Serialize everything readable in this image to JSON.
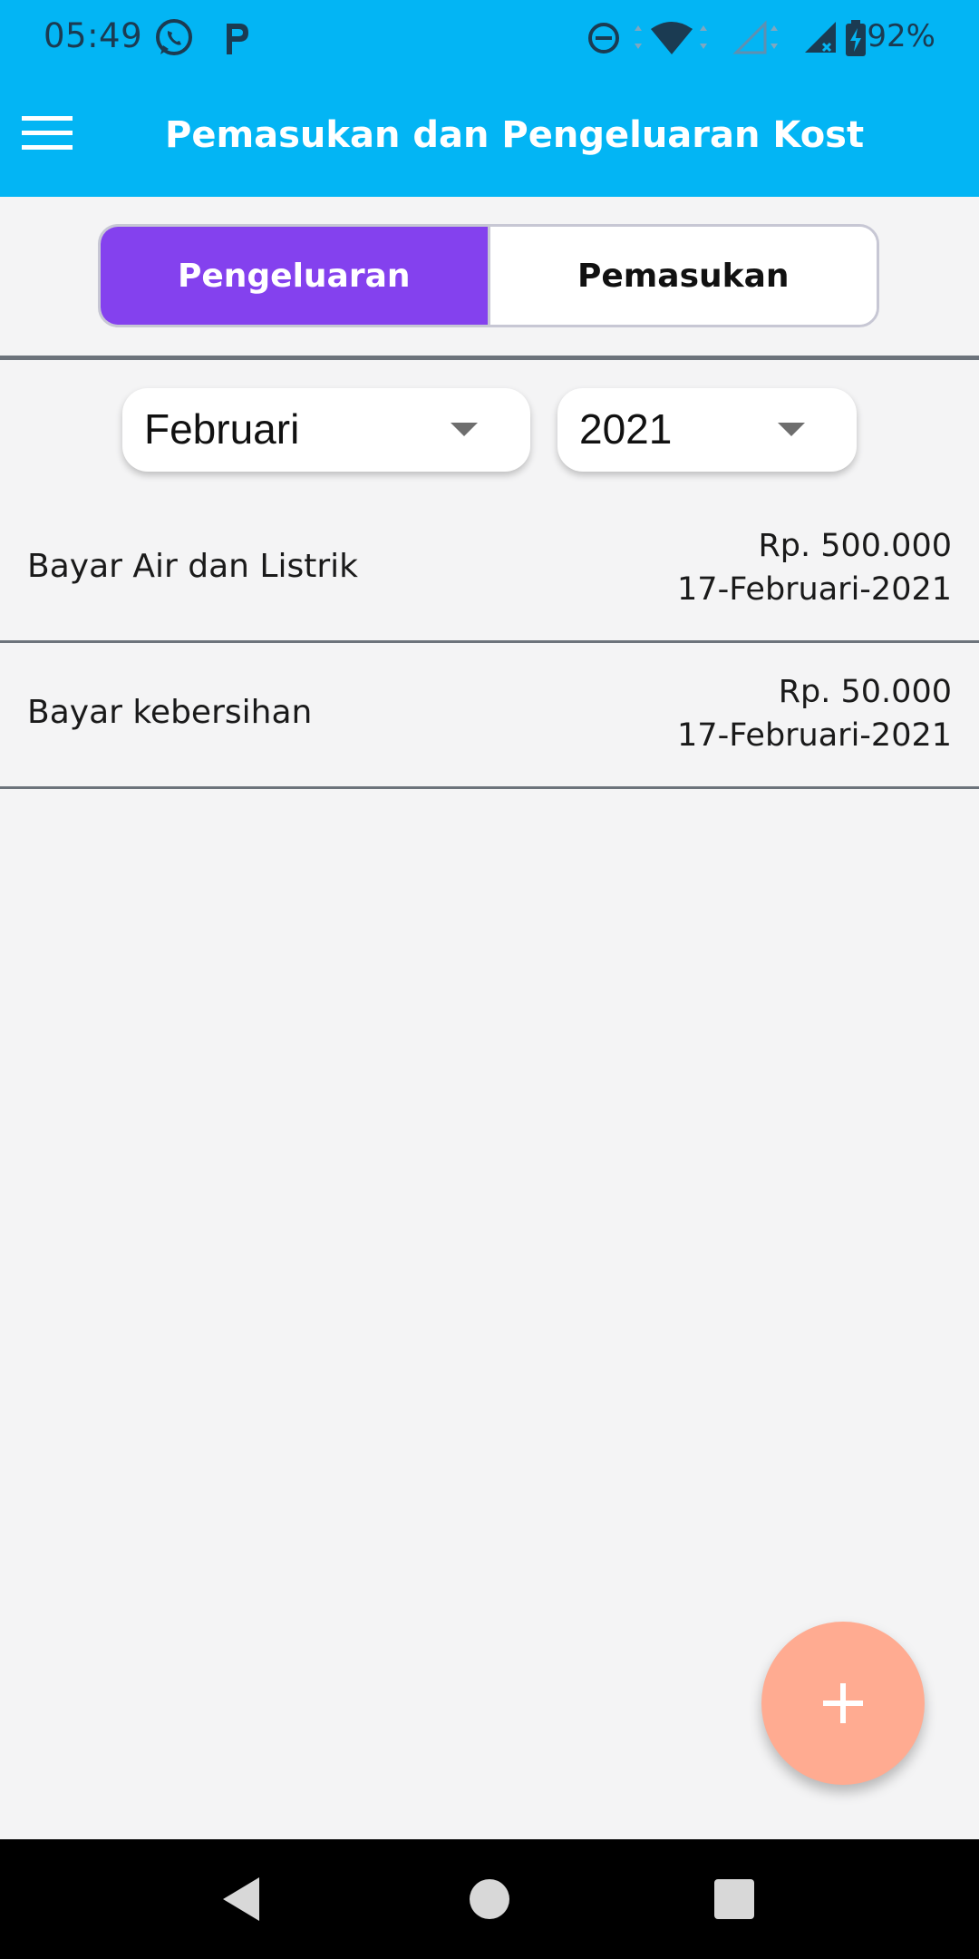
{
  "status_bar": {
    "time": "05:49",
    "left_icons": [
      "whatsapp-icon",
      "p-app-icon"
    ],
    "right_icons": [
      "do-not-disturb-icon",
      "wifi-icon",
      "signal-empty-icon",
      "signal-no-data-icon",
      "battery-charging-icon"
    ],
    "battery": "92%"
  },
  "app_bar": {
    "menu_icon": "hamburger-menu-icon",
    "title": "Pemasukan dan Pengeluaran Kost"
  },
  "tabs": {
    "active_label": "Pengeluaran",
    "inactive_label": "Pemasukan"
  },
  "filters": {
    "month": "Februari",
    "year": "2021"
  },
  "transactions": [
    {
      "title": "Bayar Air dan Listrik",
      "amount": "Rp. 500.000",
      "date": "17-Februari-2021"
    },
    {
      "title": "Bayar kebersihan",
      "amount": "Rp. 50.000",
      "date": "17-Februari-2021"
    }
  ],
  "fab": {
    "icon": "plus-icon"
  },
  "nav_bar": {
    "icons": [
      "back-icon",
      "home-icon",
      "recents-icon"
    ]
  },
  "colors": {
    "app_bar": "#03b5f4",
    "active_tab": "#8441ee",
    "fab": "#ffab91",
    "background": "#f4f4f5"
  }
}
